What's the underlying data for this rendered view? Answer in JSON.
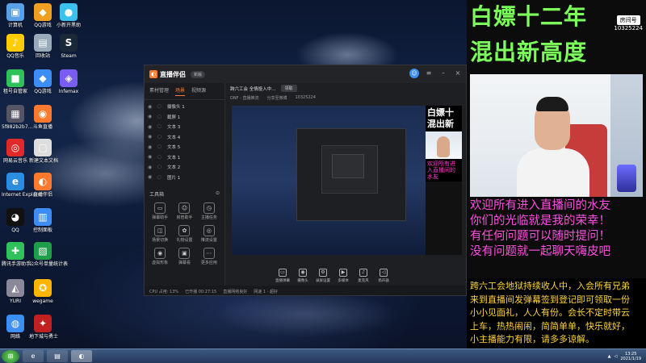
{
  "desktop": {
    "icons": [
      {
        "label": "计算机",
        "glyph": "▣",
        "color": "#5aa0e6"
      },
      {
        "label": "QQ游戏",
        "glyph": "◆",
        "color": "#f0a020"
      },
      {
        "label": "小新开黑助",
        "glyph": "●",
        "color": "#3cc0f0"
      },
      {
        "label": "QQ音乐",
        "glyph": "♪",
        "color": "#ffcc00"
      },
      {
        "label": "回收站",
        "glyph": "▤",
        "color": "#9ab"
      },
      {
        "label": "Steam",
        "glyph": "S",
        "color": "#1b2838"
      },
      {
        "label": "租号自管家",
        "glyph": "■",
        "color": "#2fc25b"
      },
      {
        "label": "QQ游戏",
        "glyph": "◆",
        "color": "#3c8ef5"
      },
      {
        "label": "Infemax",
        "glyph": "◈",
        "color": "#7b5cf0"
      },
      {
        "label": "5f882b2b7...",
        "glyph": "▦",
        "color": "#556"
      },
      {
        "label": "斗鱼直播",
        "glyph": "◉",
        "color": "#ff7a2e"
      },
      {
        "label": "网易云音乐",
        "glyph": "◎",
        "color": "#e02a2a"
      },
      {
        "label": "新建文本文档",
        "glyph": "▢",
        "color": "#ddd"
      },
      {
        "label": "Internet Explorer",
        "glyph": "e",
        "color": "#2a8de0"
      },
      {
        "label": "直播伴侣",
        "glyph": "◐",
        "color": "#ff7a2e"
      },
      {
        "label": "QQ",
        "glyph": "◕",
        "color": "#111"
      },
      {
        "label": "控制面板",
        "glyph": "▥",
        "color": "#3c8ef5"
      },
      {
        "label": "腾讯手游助手",
        "glyph": "✚",
        "color": "#2fc25b"
      },
      {
        "label": "公众号单量统计表",
        "glyph": "▧",
        "color": "#1f9e4a"
      },
      {
        "label": "YURI",
        "glyph": "◭",
        "color": "#889"
      },
      {
        "label": "wegame",
        "glyph": "✪",
        "color": "#ffb400"
      },
      {
        "label": "网络",
        "glyph": "◍",
        "color": "#3c8ef5"
      },
      {
        "label": "地下城与勇士",
        "glyph": "✦",
        "color": "#c02020"
      }
    ]
  },
  "app": {
    "name": "直播伴侣",
    "version_pill": "新版",
    "tabs": [
      "素材管理",
      "场景",
      "视频源"
    ],
    "active_tab": "场景",
    "layers": [
      {
        "label": "摄像头 1"
      },
      {
        "label": "截屏 1"
      },
      {
        "label": "文本 3"
      },
      {
        "label": "文本 4"
      },
      {
        "label": "文本 5"
      },
      {
        "label": "文本 1"
      },
      {
        "label": "文本 2"
      },
      {
        "label": "图片 1"
      }
    ],
    "tools_title": "工具箱",
    "tools": [
      {
        "label": "弹幕助手",
        "glyph": "▭"
      },
      {
        "label": "房管助手",
        "glyph": "☺"
      },
      {
        "label": "主播任务",
        "glyph": "◷"
      },
      {
        "label": "场景切换",
        "glyph": "◫"
      },
      {
        "label": "礼物设置",
        "glyph": "✿"
      },
      {
        "label": "推流设置",
        "glyph": "◎"
      },
      {
        "label": "虚拟形象",
        "glyph": "◉"
      },
      {
        "label": "弹幕看",
        "glyph": "▣"
      },
      {
        "label": "更多应用",
        "glyph": "⋯"
      }
    ],
    "notice": "跨六工会 全情投入中...",
    "notice_button": "领取",
    "info": [
      "DNF - 直播推流",
      "分享至微博",
      "10325224"
    ],
    "preview_mini_title": "白嫖十",
    "preview_mini_title2": "混出新",
    "preview_mini_text": "欢迎所有进入直播间的水友",
    "controls": [
      {
        "label": "直播弹幕",
        "glyph": "▭"
      },
      {
        "label": "摄像头",
        "glyph": "◉"
      },
      {
        "label": "录屏设置",
        "glyph": "⚙"
      },
      {
        "label": "多媒体",
        "glyph": "▶"
      },
      {
        "label": "麦克风",
        "glyph": "♪"
      },
      {
        "label": "扬声器",
        "glyph": "◁"
      }
    ],
    "status_items": [
      "CPU 占用: 13%",
      "已开播 00:27:15",
      "直播网络良好",
      "网速 1 - 超好"
    ]
  },
  "overlay": {
    "title_line1": "白嫖十二年",
    "title_line2": "混出新高度",
    "room_badge": "房间号",
    "room_number": "10325224",
    "welcome_lines": [
      "欢迎所有进入直播间的水友",
      "你们的光临就是我的荣幸！",
      "有任何问题可以随时提问！",
      "没有问题就一起聊天嗨皮吧"
    ],
    "guild_lines": [
      "跨六工会地狱持续收人中，入会所有兄弟",
      "来到直播间发弹幕签到登记即可领取一份",
      "小小见面礼，人人有份。会长不定时带云",
      "上车，热热闹闹，简简单单，快乐就好，",
      "小主播能力有限，请多多谅解。"
    ]
  },
  "taskbar": {
    "items": [
      "ie",
      "folder",
      "app"
    ],
    "time": "13:25",
    "date": "2021/1/19"
  }
}
